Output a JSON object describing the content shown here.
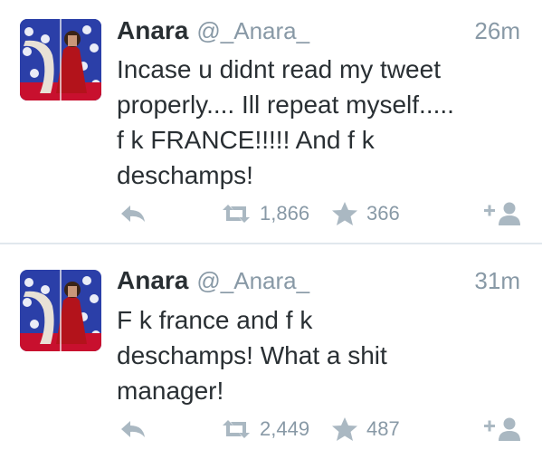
{
  "tweets": [
    {
      "name": "Anara",
      "handle": "@_Anara_",
      "time": "26m",
      "text": "Incase u didnt read my tweet\nproperly.... Ill repeat myself.....\nf     k FRANCE!!!!! And f     k\ndeschamps!",
      "retweets": "1,866",
      "favorites": "366"
    },
    {
      "name": "Anara",
      "handle": "@_Anara_",
      "time": "31m",
      "text": "F     k france and f     k\ndeschamps! What a shit\nmanager!",
      "retweets": "2,449",
      "favorites": "487"
    }
  ],
  "icons": {
    "reply": "reply-icon",
    "retweet": "retweet-icon",
    "favorite": "star-icon",
    "follow": "follow-user-icon"
  },
  "colors": {
    "icon_gray": "#aab8c2",
    "meta_gray": "#8899a6",
    "text": "#292f33",
    "divider": "#e1e8ed"
  }
}
